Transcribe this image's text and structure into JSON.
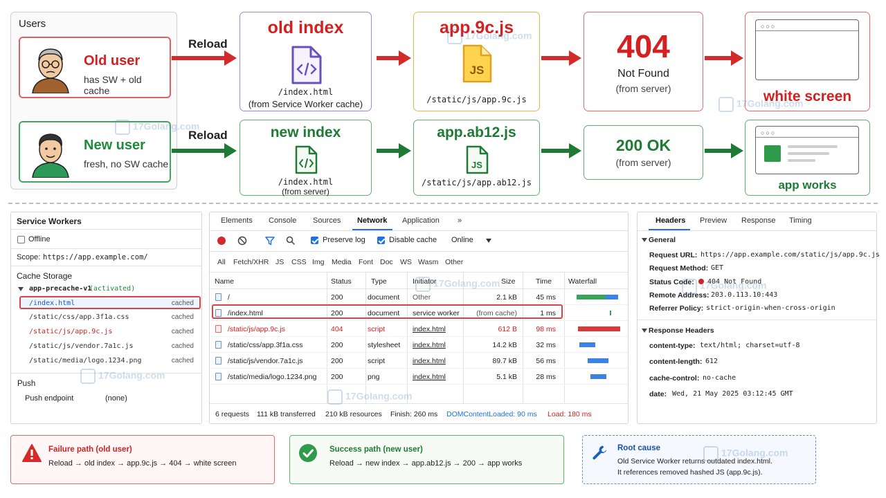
{
  "users": {
    "title": "Users",
    "old": {
      "name": "Old user",
      "desc": "has SW + old cache"
    },
    "new": {
      "name": "New user",
      "desc": "fresh, no SW cache"
    },
    "reload_label": "Reload"
  },
  "flow_old": {
    "index_title": "old index",
    "index_file": "/index.html",
    "index_note": "(from Service Worker cache)",
    "js_title": "app.9c.js",
    "js_badge": "JS",
    "js_file": "/static/js/app.9c.js",
    "status_code": "404",
    "status_text": "Not Found",
    "status_note": "(from server)",
    "result": "white screen"
  },
  "flow_new": {
    "index_title": "new index",
    "index_file": "/index.html",
    "index_note": "(from server)",
    "js_title": "app.ab12.js",
    "js_badge": "JS",
    "js_file": "/static/js/app.ab12.js",
    "status_text": "200 OK",
    "status_note": "(from server)",
    "result": "app works"
  },
  "sw_panel": {
    "title": "Service Workers",
    "offline_label": "Offline",
    "scope_label": "Scope:",
    "scope_value": "https://app.example.com/",
    "cache_title": "Cache Storage",
    "cache_name": "app-precache-v1",
    "cache_status": "(activated)",
    "entries": [
      {
        "name": "/index.html",
        "status": "cached"
      },
      {
        "name": "/static/css/app.3f1a.css",
        "status": "cached"
      },
      {
        "name": "/static/js/app.9c.js",
        "status": "cached"
      },
      {
        "name": "/static/js/vendor.7a1c.js",
        "status": "cached"
      },
      {
        "name": "/static/media/logo.1234.png",
        "status": "cached"
      }
    ],
    "push_title": "Push",
    "push_endpoint_label": "Push endpoint",
    "push_endpoint_value": "(none)"
  },
  "network": {
    "tabs": [
      "Elements",
      "Console",
      "Sources",
      "Network",
      "Application",
      "»"
    ],
    "active_tab": "Network",
    "preserve_log": "Preserve log",
    "disable_cache": "Disable cache",
    "throttle": "Online",
    "filters": [
      "All",
      "Fetch/XHR",
      "JS",
      "CSS",
      "Img",
      "Media",
      "Font",
      "Doc",
      "WS",
      "Wasm",
      "Other"
    ],
    "columns": [
      "Name",
      "Status",
      "Type",
      "Initiator",
      "Size",
      "Time",
      "Waterfall"
    ],
    "rows": [
      {
        "name": "/",
        "status": "200",
        "type": "document",
        "initiator": "Other",
        "size": "2.1 kB",
        "time": "45 ms"
      },
      {
        "name": "/index.html",
        "status": "200",
        "type": "document",
        "initiator": "service worker",
        "size": "(from cache)",
        "time": "1 ms"
      },
      {
        "name": "/static/js/app.9c.js",
        "status": "404",
        "type": "script",
        "initiator": "index.html",
        "size": "612 B",
        "time": "98 ms"
      },
      {
        "name": "/static/css/app.3f1a.css",
        "status": "200",
        "type": "stylesheet",
        "initiator": "index.html",
        "size": "14.2 kB",
        "time": "32 ms"
      },
      {
        "name": "/static/js/vendor.7a1c.js",
        "status": "200",
        "type": "script",
        "initiator": "index.html",
        "size": "89.7 kB",
        "time": "56 ms"
      },
      {
        "name": "/static/media/logo.1234.png",
        "status": "200",
        "type": "png",
        "initiator": "index.html",
        "size": "5.1 kB",
        "time": "28 ms"
      }
    ],
    "footer": {
      "requests": "6 requests",
      "transferred": "111 kB transferred",
      "resources": "210 kB resources",
      "finish": "Finish: 260 ms",
      "dcl": "DOMContentLoaded: 90 ms",
      "load": "Load: 180 ms"
    },
    "colors": {
      "blue": "#1a73e8",
      "red": "#d42020",
      "green": "#1f8a3a"
    }
  },
  "headers_panel": {
    "tabs": [
      "Headers",
      "Preview",
      "Response",
      "Timing"
    ],
    "active_tab": "Headers",
    "general_title": "General",
    "request_url_label": "Request URL:",
    "request_url": "https://app.example.com/static/js/app.9c.js",
    "request_method_label": "Request Method:",
    "request_method": "GET",
    "status_code_label": "Status Code:",
    "status_code": "404 Not Found",
    "remote_address_label": "Remote Address:",
    "remote_address": "203.0.113.10:443",
    "referrer_policy_label": "Referrer Policy:",
    "referrer_policy": "strict-origin-when-cross-origin",
    "response_headers_title": "Response Headers",
    "content_type_label": "content-type:",
    "content_type": "text/html; charset=utf-8",
    "content_length_label": "content-length:",
    "content_length": "612",
    "cache_control_label": "cache-control:",
    "cache_control": "no-cache",
    "date_label": "date:",
    "date": "Wed, 21 May 2025 03:12:45 GMT"
  },
  "summary": {
    "failure_title": "Failure path (old user)",
    "failure_line": "Reload → old index → app.9c.js → 404 → white screen",
    "success_title": "Success path (new user)",
    "success_line": "Reload → new index → app.ab12.js → 200 → app works",
    "root_title": "Root cause",
    "root_line1": "Old Service Worker returns outdated index.html.",
    "root_line2": "It references removed hashed JS (app.9c.js)."
  },
  "watermark": "17Golang.com"
}
